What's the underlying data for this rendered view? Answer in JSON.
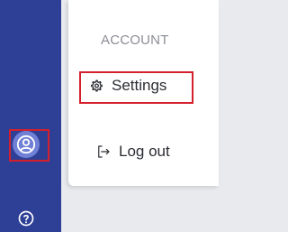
{
  "sidebar": {
    "account_icon": "user-circle-icon",
    "help_icon": "question-circle-icon"
  },
  "menu": {
    "section_label": "ACCOUNT",
    "items": [
      {
        "label": "Settings",
        "icon": "gear-icon"
      },
      {
        "label": "Log out",
        "icon": "logout-icon"
      }
    ]
  },
  "colors": {
    "sidebar_bg": "#2e3f96",
    "avatar_bg": "#6f80d6",
    "highlight": "#d4202c",
    "menu_bg": "#ffffff"
  }
}
